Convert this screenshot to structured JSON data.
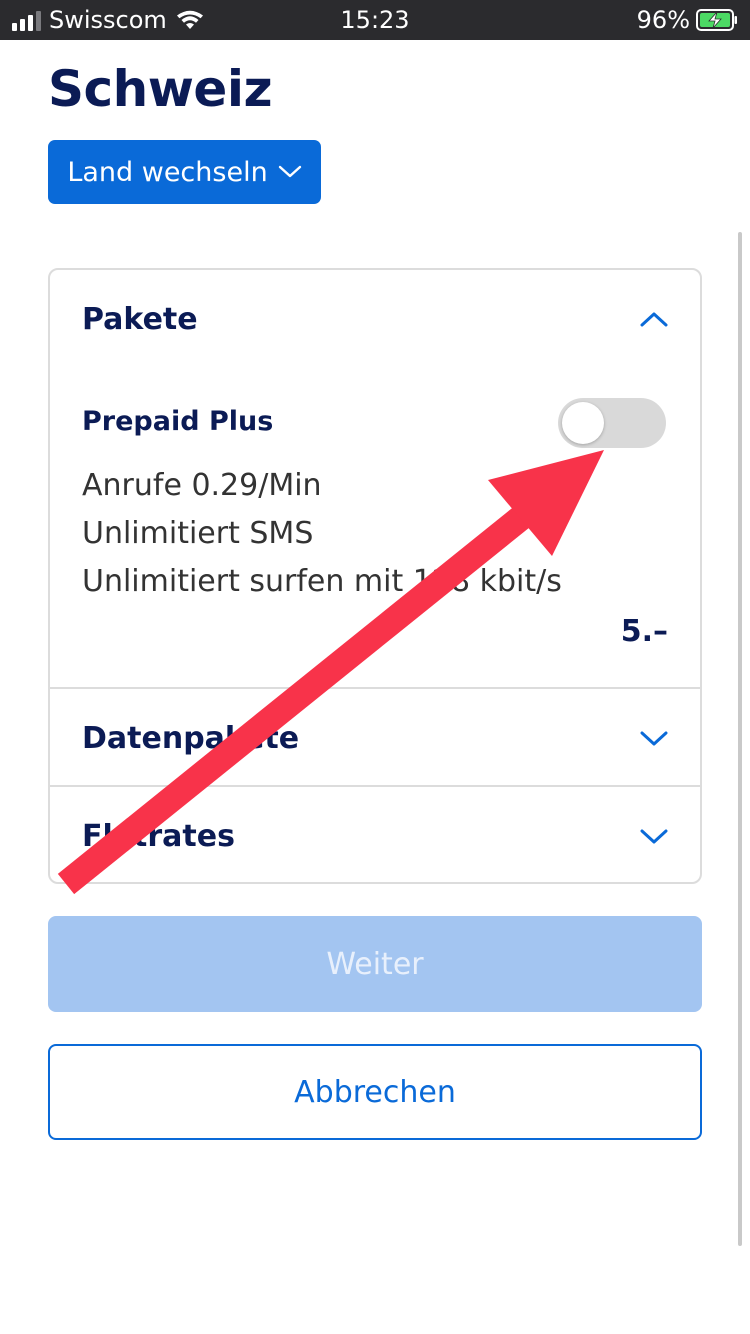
{
  "status_bar": {
    "carrier": "Swisscom",
    "time": "15:23",
    "battery_percent": "96%",
    "signal_bars": 3,
    "signal_bars_total": 4,
    "icons": [
      "signal-icon",
      "wifi-icon",
      "battery-charging-icon"
    ]
  },
  "header": {
    "title": "Schweiz",
    "change_country_label": "Land wechseln"
  },
  "sections": [
    {
      "label": "Pakete",
      "expanded": true
    },
    {
      "label": "Datenpakete",
      "expanded": false
    },
    {
      "label": "Flatrates",
      "expanded": false
    }
  ],
  "package": {
    "name": "Prepaid Plus",
    "toggle_on": false,
    "features": [
      "Anrufe 0.29/Min",
      "Unlimitiert SMS",
      "Unlimitiert surfen mit 128 kbit/s"
    ],
    "price": "5.–"
  },
  "actions": {
    "next_label": "Weiter",
    "next_enabled": false,
    "cancel_label": "Abbrechen"
  },
  "colors": {
    "brand_navy": "#0b1b55",
    "accent_blue": "#0a6ad8",
    "disabled_blue": "#a3c5f1",
    "annotation_red": "#f8334a"
  }
}
